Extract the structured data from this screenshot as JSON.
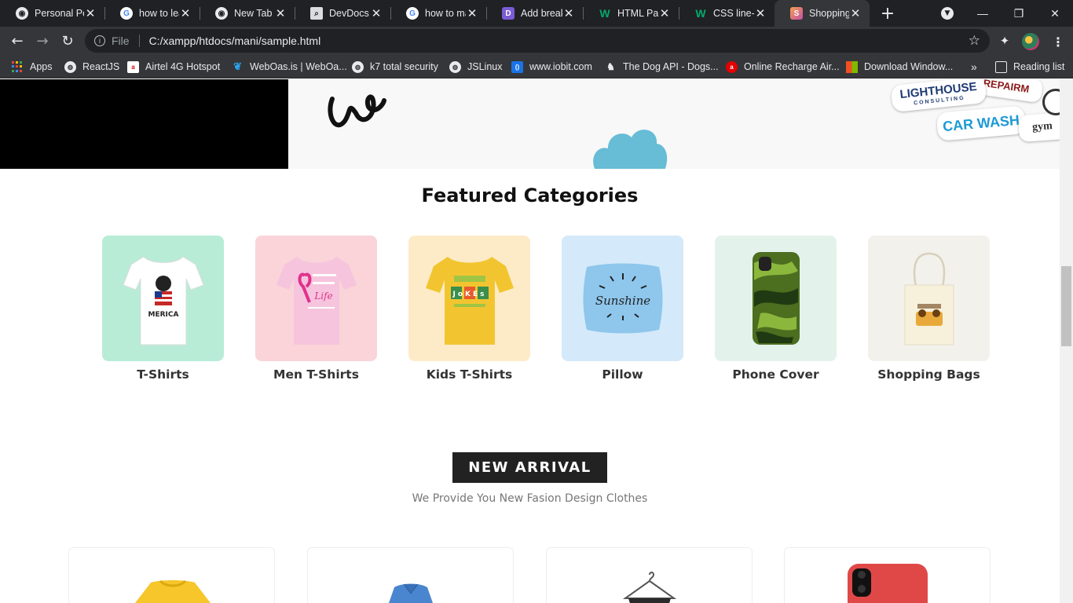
{
  "browser": {
    "tabs": [
      {
        "title": "Personal Po",
        "icon": "chrome-icon"
      },
      {
        "title": "how to lea",
        "icon": "google-icon"
      },
      {
        "title": "New Tab",
        "icon": "chrome-icon"
      },
      {
        "title": "DevDocs A",
        "icon": "devdocs-icon"
      },
      {
        "title": "how to ma",
        "icon": "google-icon"
      },
      {
        "title": "Add break",
        "icon": "discord-icon"
      },
      {
        "title": "HTML Para",
        "icon": "w3schools-icon"
      },
      {
        "title": "CSS line-he",
        "icon": "w3schools-icon"
      },
      {
        "title": "Shopping",
        "icon": "shop-icon",
        "active": true
      }
    ],
    "address": {
      "scheme": "File",
      "url": "C:/xampp/htdocs/mani/sample.html"
    },
    "bookmarks": [
      {
        "label": "Apps",
        "icon": "apps-grid-icon"
      },
      {
        "label": "ReactJS",
        "icon": "globe-icon"
      },
      {
        "label": "Airtel 4G Hotspot",
        "icon": "airtel-icon"
      },
      {
        "label": "WebOas.is | WebOa...",
        "icon": "feather-icon"
      },
      {
        "label": "k7 total security",
        "icon": "globe-icon"
      },
      {
        "label": "JSLinux",
        "icon": "globe-icon"
      },
      {
        "label": "www.iobit.com",
        "icon": "iobit-icon"
      },
      {
        "label": "The Dog API - Dogs...",
        "icon": "dog-icon"
      },
      {
        "label": "Online Recharge Air...",
        "icon": "airtel-icon"
      },
      {
        "label": "Download Window...",
        "icon": "windows-icon"
      }
    ],
    "more_bookmarks": "»",
    "reading_list": "Reading list"
  },
  "hero": {
    "stickers": [
      "LIGHTHOUSE",
      "CONSULTING",
      "CAR WASH",
      "gym",
      "REPAIRM"
    ]
  },
  "featured": {
    "title": "Featured Categories",
    "categories": [
      {
        "label": "T-Shirts",
        "bg": "#b8ecd7",
        "product_text": "MERICA"
      },
      {
        "label": "Men T-Shirts",
        "bg": "#fad4d8",
        "product_text": "Life"
      },
      {
        "label": "Kids T-Shirts",
        "bg": "#fdebc8",
        "product_text": "JoKEs"
      },
      {
        "label": "Pillow",
        "bg": "#d4e9f9",
        "product_text": "Sunshine"
      },
      {
        "label": "Phone Cover",
        "bg": "#e4f2ec",
        "product_text": ""
      },
      {
        "label": "Shopping Bags",
        "bg": "#f3f1ec",
        "product_text": ""
      }
    ]
  },
  "new_arrival": {
    "title": "NEW ARRIVAL",
    "subtitle": "We Provide You New Fasion Design Clothes"
  },
  "colors": {
    "accent_dark": "#222222",
    "page_bg": "#ffffff",
    "cloud": "#67bcd6"
  }
}
